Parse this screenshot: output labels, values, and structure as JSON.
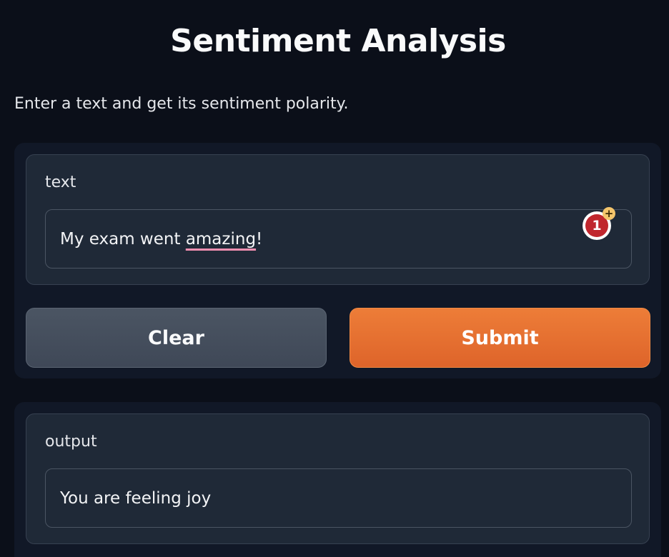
{
  "header": {
    "title": "Sentiment Analysis",
    "description": "Enter a text and get its sentiment polarity."
  },
  "input": {
    "label": "text",
    "value_prefix": "My exam went ",
    "value_misspelled": "amazing",
    "value_suffix": "!",
    "badge_count": "1",
    "badge_plus": "+"
  },
  "buttons": {
    "clear_label": "Clear",
    "submit_label": "Submit"
  },
  "output": {
    "label": "output",
    "value": "You are feeling joy"
  },
  "colors": {
    "background": "#0b0f19",
    "panel": "#111827",
    "block": "#1f2937",
    "submit": "#e8722f",
    "clear": "#4b5563",
    "spellcheck_underline": "#f48fb1",
    "badge": "#c0262d"
  }
}
